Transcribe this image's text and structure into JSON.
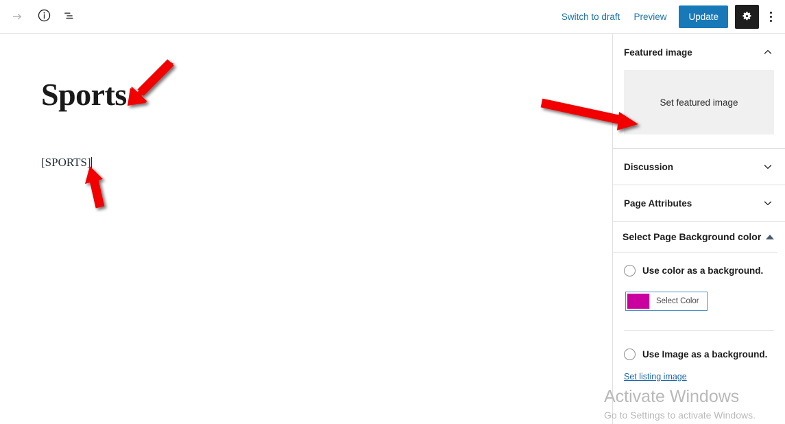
{
  "header": {
    "icons": {
      "redo": "redo-arrow-icon",
      "info": "info-circle-icon",
      "list_view": "list-view-icon",
      "settings": "gear-icon",
      "more": "kebab-menu-icon"
    },
    "switch_to_draft_label": "Switch to draft",
    "preview_label": "Preview",
    "update_label": "Update",
    "accent_color": "#1879b9",
    "link_color": "#1e73a8"
  },
  "editor": {
    "post_title": "Sports",
    "shortcode_text": "[SPORTS]"
  },
  "sidebar": {
    "featured_image": {
      "title": "Featured image",
      "toggle_state": "expanded",
      "set_image_label": "Set featured image"
    },
    "discussion": {
      "title": "Discussion",
      "toggle_state": "collapsed"
    },
    "page_attributes": {
      "title": "Page Attributes",
      "toggle_state": "collapsed"
    },
    "background_color": {
      "title": "Select Page Background color",
      "toggle_state": "expanded",
      "use_color_label": "Use color as a background.",
      "use_color_selected": false,
      "select_color_label": "Select Color",
      "selected_color": "#c9009e",
      "use_image_label": "Use Image as a background.",
      "use_image_selected": false,
      "set_listing_image_label": "Set listing image"
    }
  },
  "watermark": {
    "title": "Activate Windows",
    "subtitle": "Go to Settings to activate Windows."
  },
  "annotations": {
    "arrow_color": "#f20000",
    "arrow_1_target": "post-title",
    "arrow_2_target": "shortcode-block",
    "arrow_3_target": "featured-image-dropzone"
  }
}
